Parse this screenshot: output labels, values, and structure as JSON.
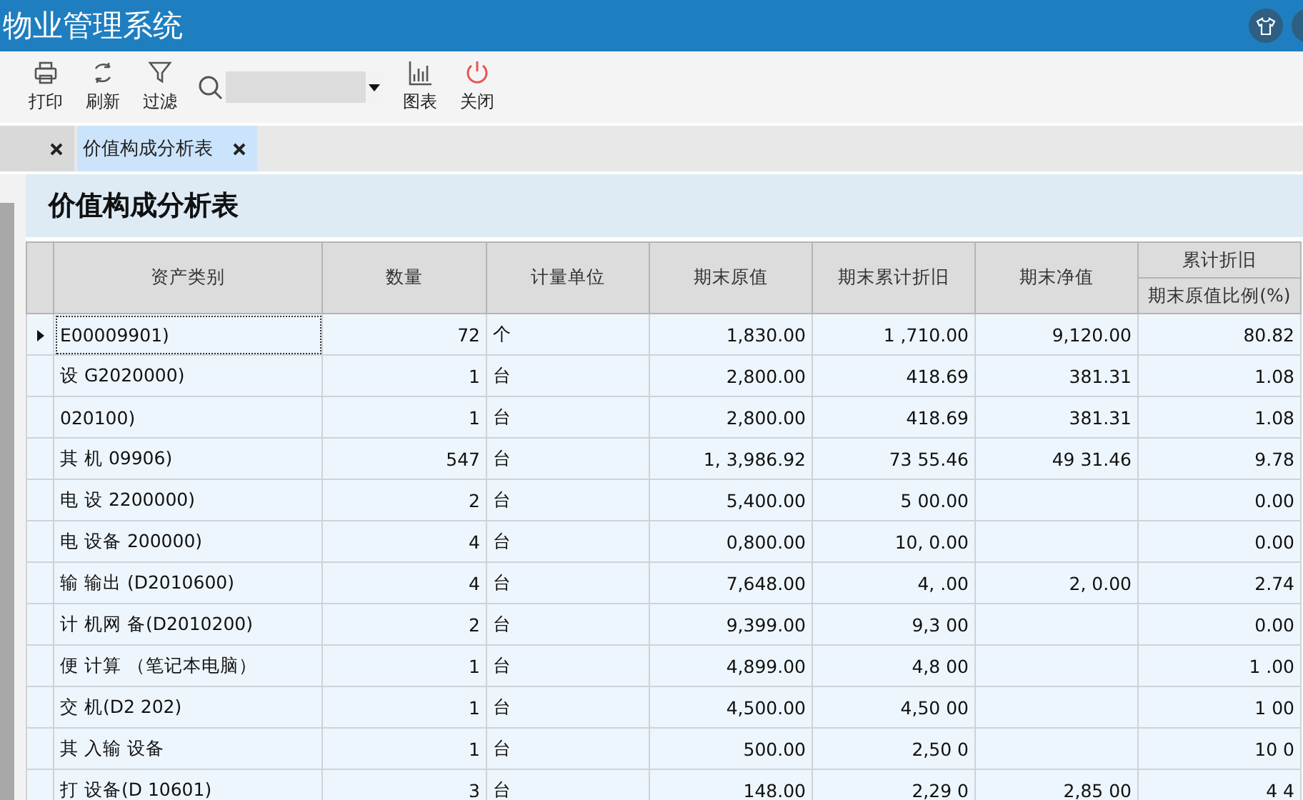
{
  "window": {
    "title": "物业管理系统"
  },
  "toolbar": [
    {
      "label": "打印",
      "kind": "printer"
    },
    {
      "label": "刷新",
      "kind": "refresh"
    },
    {
      "label": "过滤",
      "kind": "filter"
    },
    {
      "kind": "search"
    },
    {
      "label": "图表",
      "kind": "chart"
    },
    {
      "label": "关闭",
      "kind": "power"
    }
  ],
  "tabs": [
    {
      "selected": false
    },
    {
      "label": "价值构成分析表",
      "selected": true
    }
  ],
  "report": {
    "title": "价值构成分析表",
    "columns": [
      "资产类别",
      "数量",
      "计量单位",
      "期末原值",
      "期末累计折旧",
      "期末净值"
    ],
    "group_column": {
      "label": "累计折旧",
      "sub": "期末原值比例(%)"
    },
    "rows": [
      {
        "selected": true,
        "cells": [
          "E00009901)",
          "72",
          "个",
          "1,830.00",
          "1 ,710.00",
          "9,120.00",
          "80.82"
        ]
      },
      {
        "selected": false,
        "cells": [
          "设 G2020000)",
          "1",
          "台",
          "2,800.00",
          "418.69",
          "381.31",
          "1.08"
        ]
      },
      {
        "selected": false,
        "cells": [
          "020100)",
          "1",
          "台",
          "2,800.00",
          "418.69",
          "381.31",
          "1.08"
        ]
      },
      {
        "selected": false,
        "cells": [
          "其 机 09906)",
          "547",
          "台",
          "1, 3,986.92",
          "73 55.46",
          "49 31.46",
          "9.78"
        ]
      },
      {
        "selected": false,
        "cells": [
          "电 设 2200000)",
          "2",
          "台",
          "5,400.00",
          "5 00.00",
          "",
          "0.00"
        ]
      },
      {
        "selected": false,
        "cells": [
          "电 设备 200000)",
          "4",
          "台",
          "0,800.00",
          "10, 0.00",
          "",
          "0.00"
        ]
      },
      {
        "selected": false,
        "cells": [
          "输 输出 (D2010600)",
          "4",
          "台",
          "7,648.00",
          "4, .00",
          "2, 0.00",
          "2.74"
        ]
      },
      {
        "selected": false,
        "cells": [
          "计 机网 备(D2010200)",
          "2",
          "台",
          "9,399.00",
          "9,3 00",
          "",
          "0.00"
        ]
      },
      {
        "selected": false,
        "cells": [
          "便 计算 （笔记本电脑）",
          "1",
          "台",
          "4,899.00",
          "4,8 00",
          "",
          "1 .00"
        ]
      },
      {
        "selected": false,
        "cells": [
          "交 机(D2 202)",
          "1",
          "台",
          "4,500.00",
          "4,50 00",
          "",
          "1 00"
        ]
      },
      {
        "selected": false,
        "cells": [
          "其 入输 设备",
          "1",
          "台",
          "500.00",
          "2,50 0",
          "",
          "10 0"
        ]
      },
      {
        "selected": false,
        "cells": [
          "打 设备(D 10601)",
          "3",
          "台",
          "148.00",
          "2,29 0",
          "2,85 00",
          "4 4"
        ]
      }
    ]
  }
}
